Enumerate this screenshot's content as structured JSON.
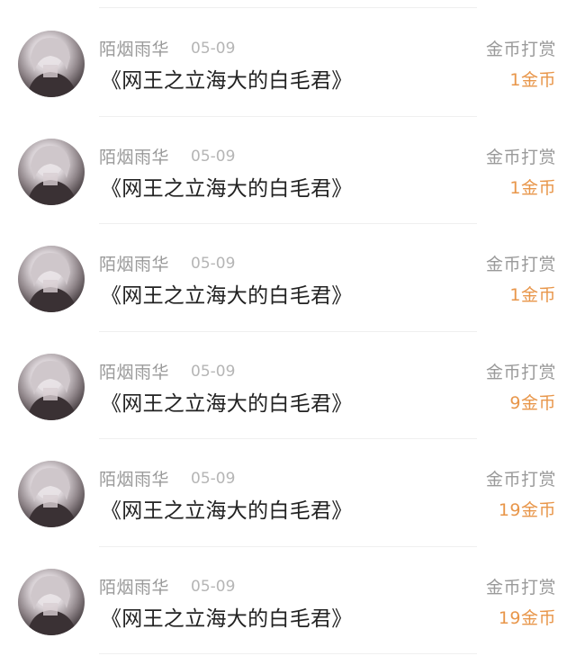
{
  "colors": {
    "amount": "#e8964a",
    "secondary_text": "#9a9a9a",
    "date_text": "#b5b5b5",
    "title_text": "#222222",
    "divider": "#efefef"
  },
  "label_reward": "金币打赏",
  "items": [
    {
      "user": "陌烟雨华",
      "date": "05-09",
      "book": "《网王之立海大的白毛君》",
      "reward_label": "金币打赏",
      "amount": "1金币"
    },
    {
      "user": "陌烟雨华",
      "date": "05-09",
      "book": "《网王之立海大的白毛君》",
      "reward_label": "金币打赏",
      "amount": "1金币"
    },
    {
      "user": "陌烟雨华",
      "date": "05-09",
      "book": "《网王之立海大的白毛君》",
      "reward_label": "金币打赏",
      "amount": "1金币"
    },
    {
      "user": "陌烟雨华",
      "date": "05-09",
      "book": "《网王之立海大的白毛君》",
      "reward_label": "金币打赏",
      "amount": "9金币"
    },
    {
      "user": "陌烟雨华",
      "date": "05-09",
      "book": "《网王之立海大的白毛君》",
      "reward_label": "金币打赏",
      "amount": "19金币"
    },
    {
      "user": "陌烟雨华",
      "date": "05-09",
      "book": "《网王之立海大的白毛君》",
      "reward_label": "金币打赏",
      "amount": "19金币"
    }
  ]
}
